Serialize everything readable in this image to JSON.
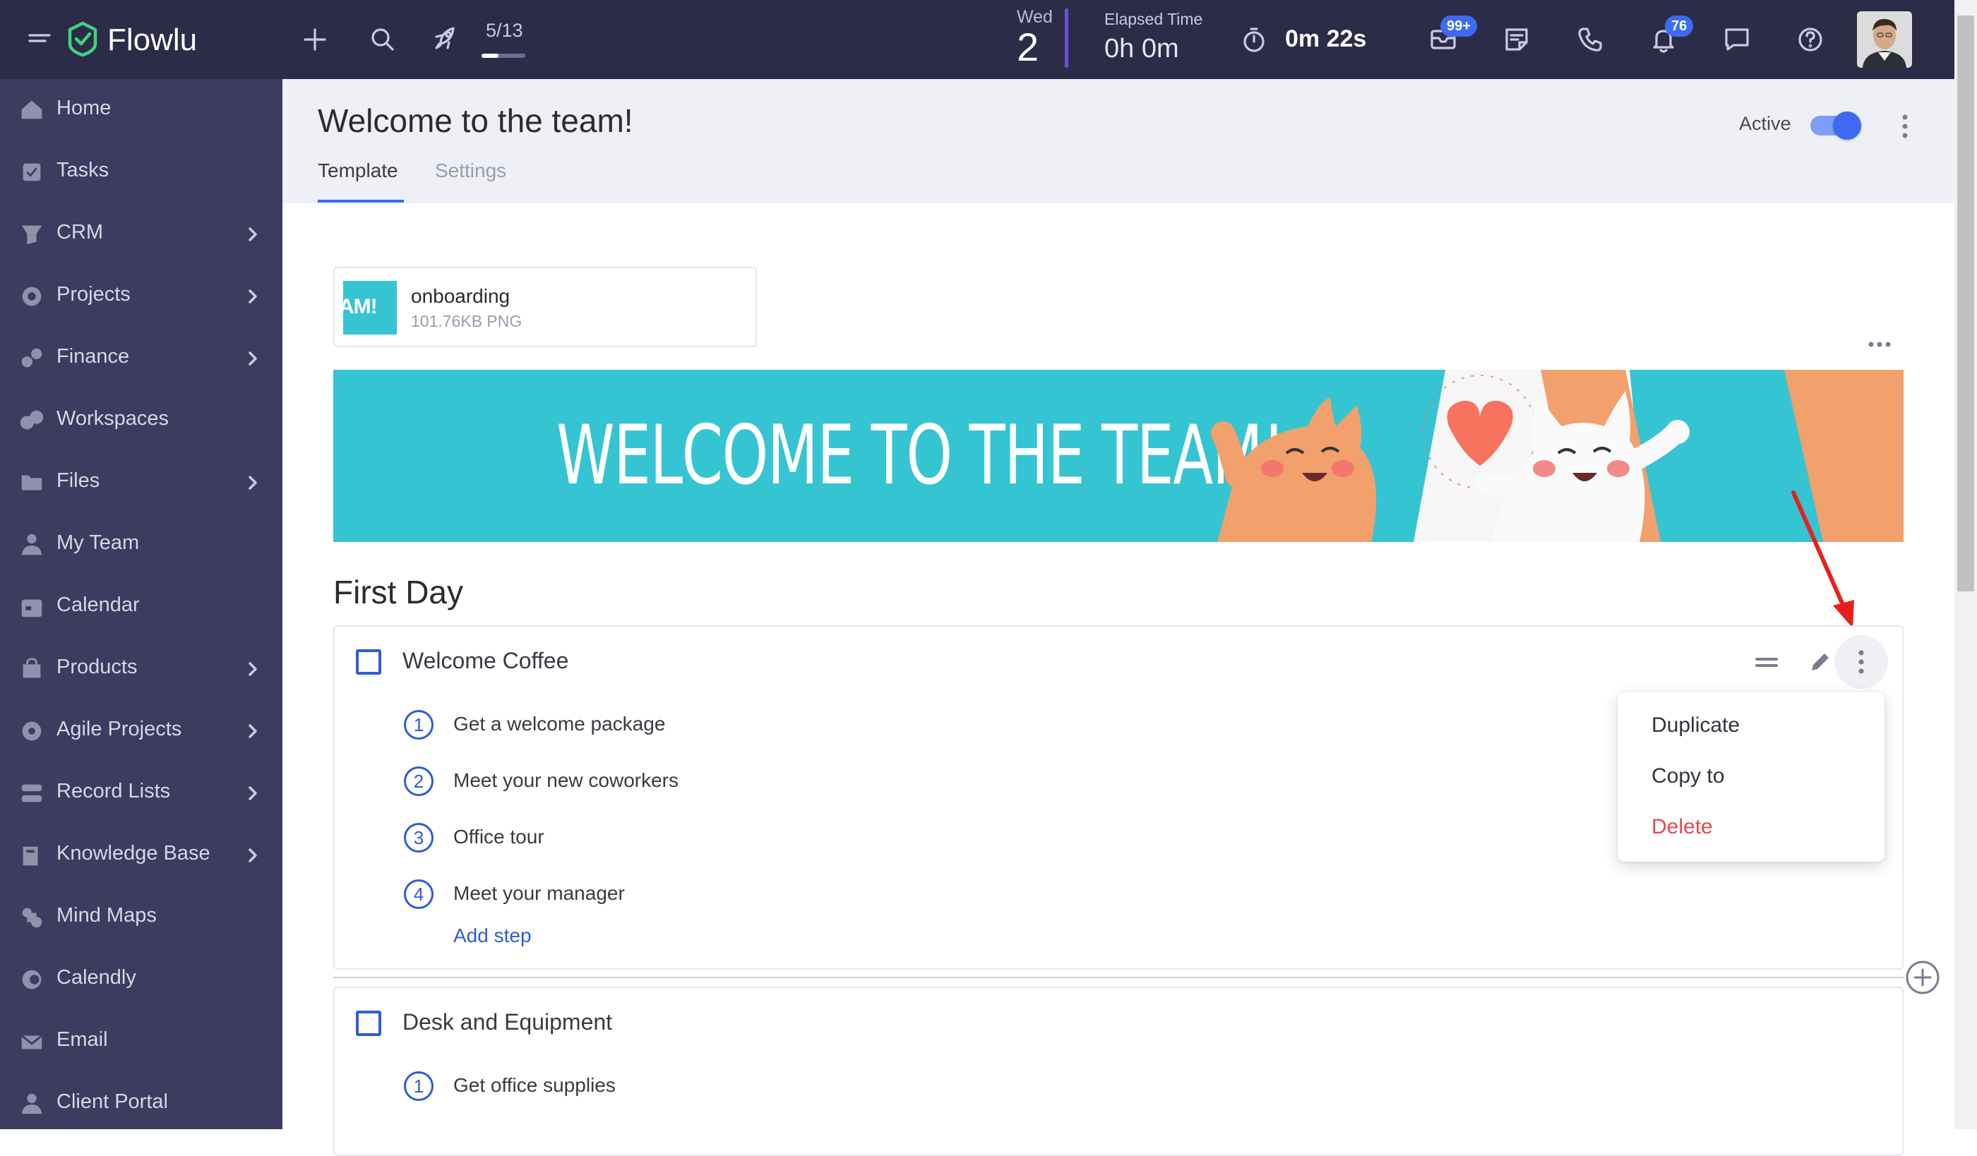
{
  "topbar": {
    "brand": "Flowlu",
    "counter": "5/13",
    "day_name": "Wed",
    "day_number": "2",
    "elapsed_label": "Elapsed Time",
    "elapsed_value": "0h 0m",
    "timer_value": "0m 22s",
    "mail_badge": "99+",
    "notif_badge": "76",
    "counter_progress": 0.38
  },
  "sidebar": {
    "items": [
      {
        "label": "Home",
        "icon": "home-icon",
        "has_submenu": false
      },
      {
        "label": "Tasks",
        "icon": "tasks-icon",
        "has_submenu": false
      },
      {
        "label": "CRM",
        "icon": "crm-icon",
        "has_submenu": true
      },
      {
        "label": "Projects",
        "icon": "projects-icon",
        "has_submenu": true
      },
      {
        "label": "Finance",
        "icon": "finance-icon",
        "has_submenu": true
      },
      {
        "label": "Workspaces",
        "icon": "workspaces-icon",
        "has_submenu": false
      },
      {
        "label": "Files",
        "icon": "files-icon",
        "has_submenu": true
      },
      {
        "label": "My Team",
        "icon": "team-icon",
        "has_submenu": false
      },
      {
        "label": "Calendar",
        "icon": "calendar-icon",
        "has_submenu": false
      },
      {
        "label": "Products",
        "icon": "products-icon",
        "has_submenu": true
      },
      {
        "label": "Agile Projects",
        "icon": "agile-icon",
        "has_submenu": true
      },
      {
        "label": "Record Lists",
        "icon": "record-lists-icon",
        "has_submenu": true
      },
      {
        "label": "Knowledge Base",
        "icon": "knowledge-base-icon",
        "has_submenu": true
      },
      {
        "label": "Mind Maps",
        "icon": "mind-maps-icon",
        "has_submenu": false
      },
      {
        "label": "Calendly",
        "icon": "calendly-icon",
        "has_submenu": false
      },
      {
        "label": "Email",
        "icon": "email-icon",
        "has_submenu": false
      },
      {
        "label": "Client Portal",
        "icon": "client-portal-icon",
        "has_submenu": false
      }
    ]
  },
  "page": {
    "title": "Welcome to the team!",
    "tabs": [
      "Template",
      "Settings"
    ],
    "active_label": "Active",
    "active_on": true
  },
  "attachment": {
    "name": "onboarding",
    "meta": "101.76KB PNG",
    "thumb_text": "AM!"
  },
  "banner": {
    "text": "WELCOME TO THE TEAM!"
  },
  "section": {
    "title": "First Day"
  },
  "tasks": [
    {
      "title": "Welcome Coffee",
      "steps": [
        "Get a welcome package",
        "Meet your new coworkers",
        "Office tour",
        "Meet your manager"
      ],
      "add_step": "Add step"
    },
    {
      "title": "Desk and Equipment",
      "steps": [
        "Get office supplies"
      ]
    }
  ],
  "context_menu": {
    "items": [
      "Duplicate",
      "Copy to",
      "Delete"
    ],
    "danger_color": "#e5484d"
  },
  "colors": {
    "accent": "#3d6af0",
    "topbar": "#2c2c48",
    "sidebar": "#3b3c5f",
    "banner": "#35c4d2",
    "brand_green": "#3fd27f"
  }
}
